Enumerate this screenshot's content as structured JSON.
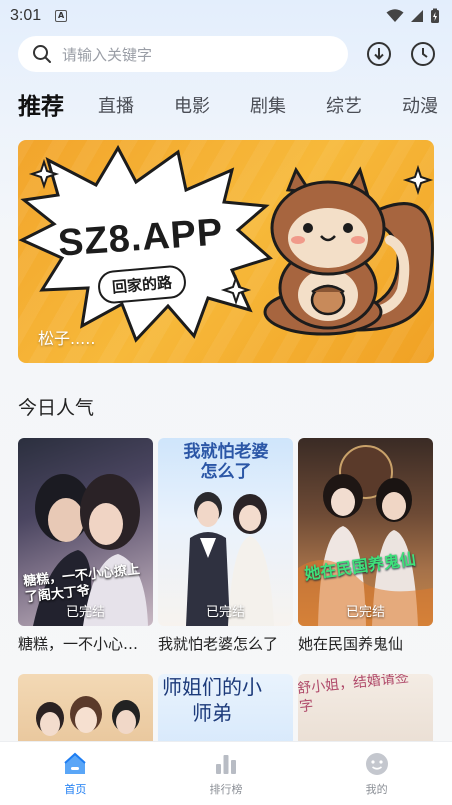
{
  "status_bar": {
    "time": "3:01",
    "notification_letter": "A"
  },
  "search": {
    "placeholder": "请输入关键字"
  },
  "tabs": [
    {
      "label": "推荐",
      "active": true
    },
    {
      "label": "直播",
      "active": false
    },
    {
      "label": "电影",
      "active": false
    },
    {
      "label": "剧集",
      "active": false
    },
    {
      "label": "综艺",
      "active": false
    },
    {
      "label": "动漫",
      "active": false
    }
  ],
  "banner": {
    "headline": "SZ8.APP",
    "subline": "回家的路",
    "caption": "松子.....",
    "colors": {
      "background": "#f2a52c",
      "squirrel": "#9a5a3a"
    }
  },
  "section": {
    "title": "今日人气"
  },
  "cards_row1": [
    {
      "title": "糖糕，一不小心撩上了...",
      "status": "已完结",
      "poster_text": "糖糕，一不小心撩上了阁大丁爷"
    },
    {
      "title": "我就怕老婆怎么了",
      "status": "已完结",
      "poster_text": "我就怕老婆怎么了"
    },
    {
      "title": "她在民国养鬼仙",
      "status": "已完结",
      "poster_text": "她在民国养鬼仙"
    }
  ],
  "cards_row2": [
    {
      "poster_text": ""
    },
    {
      "poster_text": "师姐们的小师弟"
    },
    {
      "poster_text": "舒小姐，结婚请签字"
    }
  ],
  "bottom_nav": [
    {
      "label": "首页",
      "icon": "home-icon",
      "active": true
    },
    {
      "label": "排行榜",
      "icon": "ranking-icon",
      "active": false
    },
    {
      "label": "我的",
      "icon": "profile-icon",
      "active": false
    }
  ],
  "colors": {
    "accent": "#1d7df2",
    "text_muted": "#8b8f96"
  }
}
